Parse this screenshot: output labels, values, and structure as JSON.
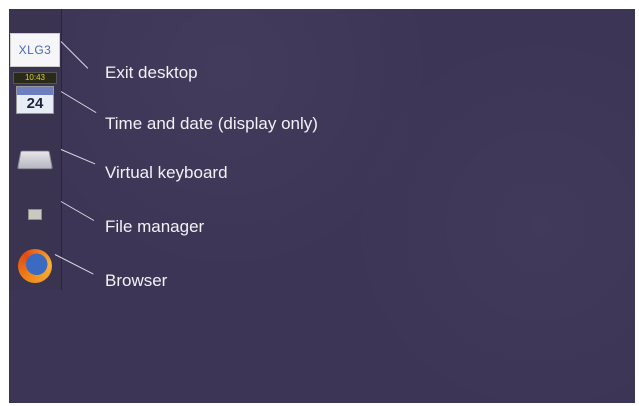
{
  "dock": {
    "exit_icon_text": "XLG3",
    "clock_time": "10:43",
    "clock_day": "24"
  },
  "callouts": {
    "exit": "Exit desktop",
    "time": "Time and date (display only)",
    "keyboard": "Virtual keyboard",
    "files": "File manager",
    "browser": "Browser"
  },
  "colors": {
    "desktop_background": "#3d3556",
    "label_text": "#f2f2f6"
  }
}
